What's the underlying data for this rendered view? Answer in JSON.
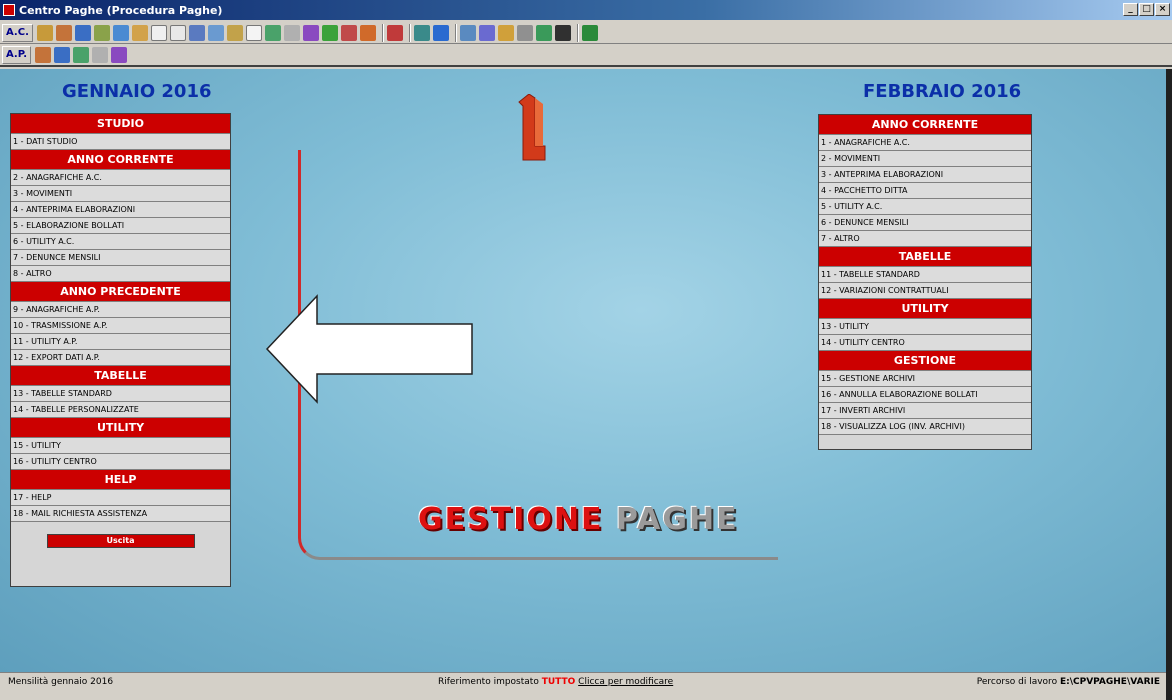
{
  "window": {
    "title": "Centro Paghe (Procedura Paghe)",
    "min": "_",
    "max": "□",
    "close": "×"
  },
  "toolbar1": {
    "label": "A.C."
  },
  "toolbar2": {
    "label": "A.P."
  },
  "left": {
    "month": "GENNAIO 2016",
    "sections": [
      {
        "title": "STUDIO",
        "items": [
          "1 - DATI STUDIO"
        ]
      },
      {
        "title": "ANNO CORRENTE",
        "items": [
          "2 - ANAGRAFICHE A.C.",
          "3 - MOVIMENTI",
          "4 - ANTEPRIMA ELABORAZIONI",
          "5 - ELABORAZIONE BOLLATI",
          "6 - UTILITY A.C.",
          "7 - DENUNCE MENSILI",
          "8 - ALTRO"
        ]
      },
      {
        "title": "ANNO PRECEDENTE",
        "items": [
          "9 - ANAGRAFICHE A.P.",
          "10 - TRASMISSIONE A.P.",
          "11 - UTILITY A.P.",
          "12 - EXPORT DATI A.P."
        ]
      },
      {
        "title": "TABELLE",
        "items": [
          "13 - TABELLE STANDARD",
          "14 - TABELLE PERSONALIZZATE"
        ]
      },
      {
        "title": "UTILITY",
        "items": [
          "15 - UTILITY",
          "16 - UTILITY CENTRO"
        ]
      },
      {
        "title": "HELP",
        "items": [
          "17 - HELP",
          "18 - MAIL RICHIESTA ASSISTENZA"
        ]
      }
    ],
    "exit_label": "Uscita"
  },
  "right": {
    "month": "FEBBRAIO 2016",
    "sections": [
      {
        "title": "ANNO CORRENTE",
        "items": [
          "1 - ANAGRAFICHE A.C.",
          "2 - MOVIMENTI",
          "3 - ANTEPRIMA ELABORAZIONI",
          "4 - PACCHETTO DITTA",
          "5 - UTILITY A.C.",
          "6 - DENUNCE MENSILI",
          "7 - ALTRO"
        ]
      },
      {
        "title": "TABELLE",
        "items": [
          "11 - TABELLE STANDARD",
          "12 - VARIAZIONI CONTRATTUALI"
        ]
      },
      {
        "title": "UTILITY",
        "items": [
          "13 - UTILITY",
          "14 - UTILITY CENTRO"
        ]
      },
      {
        "title": "GESTIONE",
        "items": [
          "15 - GESTIONE ARCHIVI",
          "16 - ANNULLA ELABORAZIONE BOLLATI",
          "17 - INVERTI ARCHIVI",
          "18 - VISUALIZZA LOG (INV. ARCHIVI)"
        ]
      }
    ]
  },
  "logo": {
    "word1": "GESTIONE",
    "word2": "PAGHE"
  },
  "status": {
    "left": "Mensilità gennaio 2016",
    "center_prefix": "Riferimento impostato",
    "center_value": "TUTTO",
    "center_link": "Clicca per modificare",
    "right_prefix": "Percorso di lavoro",
    "right_path": "E:\\CPVPAGHE\\VARIE"
  },
  "colors": {
    "header_red": "#cc0000",
    "month_blue": "#0b2fa8",
    "background": "#7fbcd5"
  }
}
